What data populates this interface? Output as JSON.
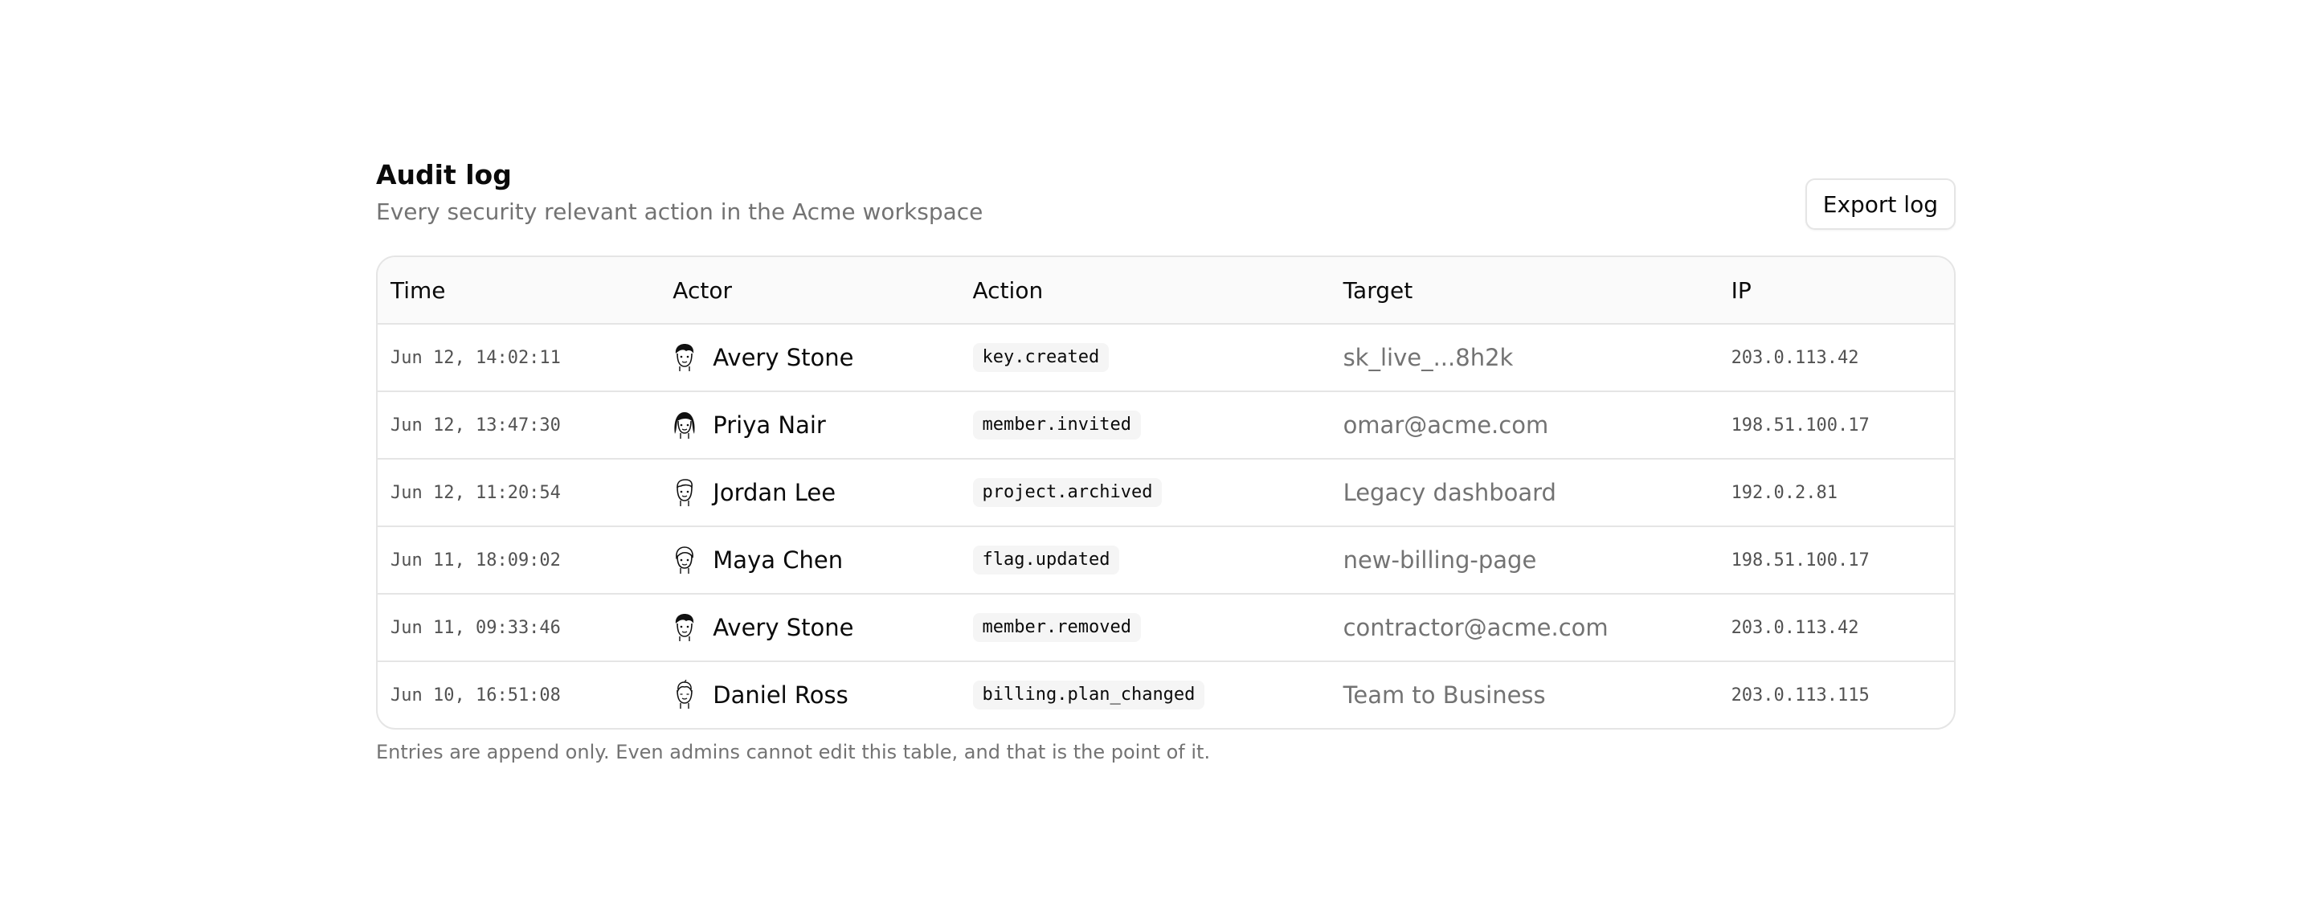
{
  "header": {
    "title": "Audit log",
    "subtitle": "Every security relevant action in the Acme workspace",
    "export_label": "Export log"
  },
  "table": {
    "columns": [
      "Time",
      "Actor",
      "Action",
      "Target",
      "IP"
    ],
    "rows": [
      {
        "time": "Jun 12, 14:02:11",
        "actor": "Avery Stone",
        "avatar": "avatar-avery-icon",
        "action": "key.created",
        "target": "sk_live_...8h2k",
        "ip": "203.0.113.42"
      },
      {
        "time": "Jun 12, 13:47:30",
        "actor": "Priya Nair",
        "avatar": "avatar-priya-icon",
        "action": "member.invited",
        "target": "omar@acme.com",
        "ip": "198.51.100.17"
      },
      {
        "time": "Jun 12, 11:20:54",
        "actor": "Jordan Lee",
        "avatar": "avatar-jordan-icon",
        "action": "project.archived",
        "target": "Legacy dashboard",
        "ip": "192.0.2.81"
      },
      {
        "time": "Jun 11, 18:09:02",
        "actor": "Maya Chen",
        "avatar": "avatar-maya-icon",
        "action": "flag.updated",
        "target": "new-billing-page",
        "ip": "198.51.100.17"
      },
      {
        "time": "Jun 11, 09:33:46",
        "actor": "Avery Stone",
        "avatar": "avatar-avery-icon",
        "action": "member.removed",
        "target": "contractor@acme.com",
        "ip": "203.0.113.42"
      },
      {
        "time": "Jun 10, 16:51:08",
        "actor": "Daniel Ross",
        "avatar": "avatar-daniel-icon",
        "action": "billing.plan_changed",
        "target": "Team to Business",
        "ip": "203.0.113.115"
      }
    ]
  },
  "footnote": "Entries are append only. Even admins cannot edit this table, and that is the point of it.",
  "colors": {
    "text": "#0a0a0a",
    "muted": "#737373",
    "border": "#e5e5e5",
    "header_bg": "#fafafa",
    "pill_bg": "#f5f5f5"
  }
}
